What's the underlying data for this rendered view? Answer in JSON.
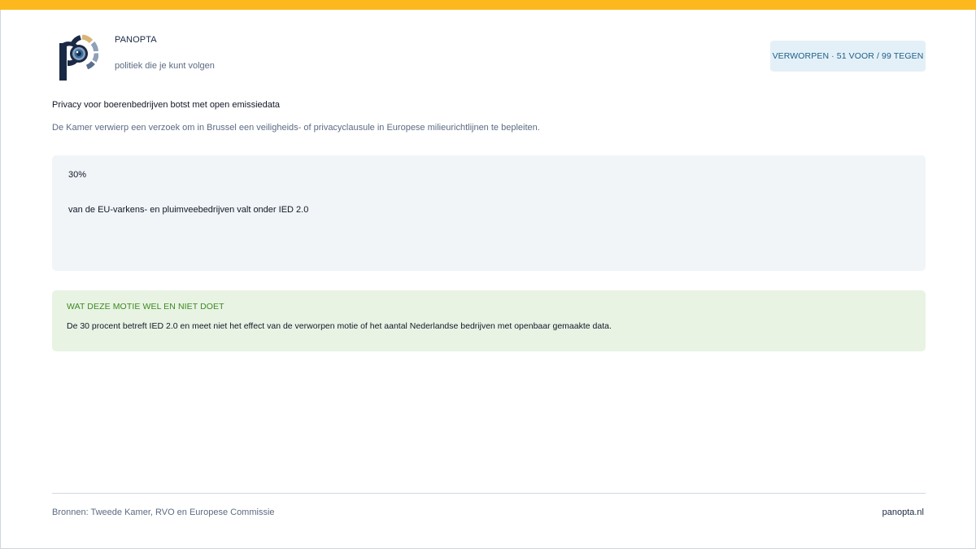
{
  "brand": {
    "name": "PANOPTA",
    "tagline": "politiek die je kunt volgen",
    "colors": {
      "accent": "#fcb81c",
      "navy": "#1a2a44"
    }
  },
  "badge": {
    "label": "VERWORPEN · 51 VOOR / 99 TEGEN"
  },
  "article": {
    "headline": "Privacy voor boerenbedrijven botst met open emissiedata",
    "subline": "De Kamer verwierp een verzoek om in Brussel een veiligheids- of privacyclausule in Europese milieurichtlijnen te bepleiten."
  },
  "stat": {
    "value": "30%",
    "description": "van de EU-varkens- en pluimveebedrijven valt onder IED 2.0"
  },
  "note": {
    "title": "WAT DEZE MOTIE WEL EN NIET DOET",
    "body": "De 30 procent betreft IED 2.0 en meet niet het effect van de verworpen motie of het aantal Nederlandse bedrijven met openbaar gemaakte data."
  },
  "footer": {
    "sources": "Bronnen: Tweede Kamer, RVO en Europese Commissie",
    "site": "panopta.nl"
  }
}
